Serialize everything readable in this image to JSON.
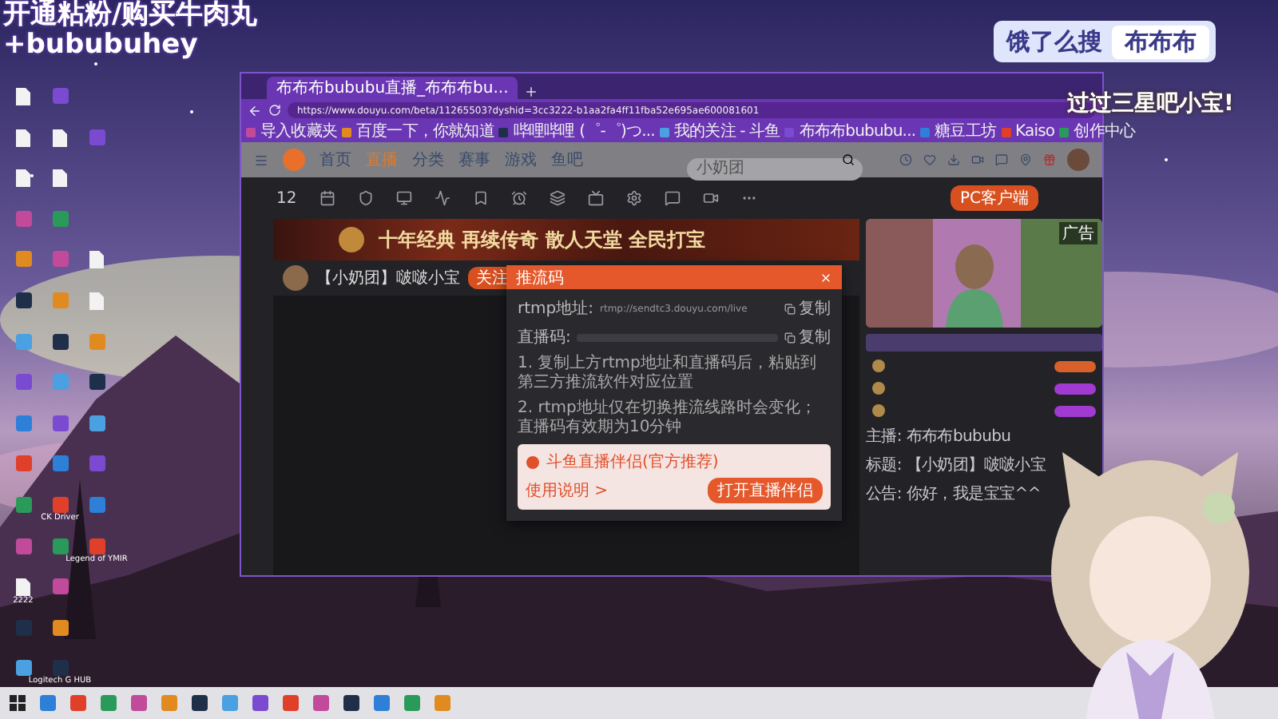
{
  "overlay": {
    "headline": [
      "开通粘粉/购买牛肉丸",
      "+bububuhey"
    ],
    "search_badge": {
      "prefix": "饿了么搜",
      "query": "布布布"
    },
    "caption": "过过三星吧小宝!"
  },
  "desktop_icons": [
    {
      "kind": "file"
    },
    {
      "kind": "file"
    },
    {
      "kind": "file"
    },
    {
      "kind": "app"
    },
    {
      "kind": "app"
    },
    {
      "kind": "app"
    },
    {
      "kind": "app"
    },
    {
      "kind": "app"
    },
    {
      "kind": "app"
    },
    {
      "kind": "app"
    },
    {
      "kind": "app"
    },
    {
      "kind": "app"
    },
    {
      "kind": "file",
      "label": "2222"
    },
    {
      "kind": "app"
    },
    {
      "kind": "app"
    },
    {
      "kind": "app"
    },
    {
      "kind": "file"
    },
    {
      "kind": "file"
    },
    {
      "kind": "app"
    },
    {
      "kind": "app"
    },
    {
      "kind": "app"
    },
    {
      "kind": "app"
    },
    {
      "kind": "app"
    },
    {
      "kind": "app"
    },
    {
      "kind": "app"
    },
    {
      "kind": "app",
      "label": "CK Driver"
    },
    {
      "kind": "app"
    },
    {
      "kind": "app"
    },
    {
      "kind": "app"
    },
    {
      "kind": "app",
      "label": "Logitech G HUB"
    },
    {
      "kind": "blank"
    },
    {
      "kind": "app"
    },
    {
      "kind": "blank"
    },
    {
      "kind": "blank"
    },
    {
      "kind": "file"
    },
    {
      "kind": "file"
    },
    {
      "kind": "app"
    },
    {
      "kind": "app"
    },
    {
      "kind": "app"
    },
    {
      "kind": "app"
    },
    {
      "kind": "app"
    },
    {
      "kind": "app",
      "label": "Legend of YMIR"
    },
    {
      "kind": "blank"
    },
    {
      "kind": "blank"
    },
    {
      "kind": "blank"
    }
  ],
  "browser": {
    "tabs": [
      {
        "title": "布布布bububu直播_布布布bu...",
        "selected": true
      }
    ],
    "url": "https://www.douyu.com/beta/11265503?dyshid=3cc3222-b1aa2fa4ff11fba52e695ae600081601",
    "bookmarks": [
      "导入收藏夹",
      "百度一下，你就知道",
      "哔哩哔哩 (゜-゜)つ...",
      "我的关注 - 斗鱼",
      "布布布bububu...",
      "糖豆工坊",
      "Kaiso",
      "创作中心"
    ]
  },
  "site": {
    "nav": [
      {
        "label": "首页",
        "selected": false
      },
      {
        "label": "直播",
        "selected": true
      },
      {
        "label": "分类",
        "selected": false
      },
      {
        "label": "赛事",
        "selected": false
      },
      {
        "label": "游戏",
        "selected": false
      },
      {
        "label": "鱼吧",
        "selected": false
      }
    ],
    "search": {
      "placeholder": "小奶团"
    },
    "toolbar": {
      "count": "12",
      "client_button": "PC客户端"
    },
    "banner": "十年经典 再续传奇 散人天堂 全民打宝",
    "room": {
      "title": "【小奶团】啵啵小宝",
      "follow_button": "关注"
    },
    "dialog": {
      "title": "推流码",
      "rows": [
        {
          "label": "rtmp地址:",
          "value": "rtmp://sendtc3.douyu.com/live",
          "action": "复制"
        },
        {
          "label": "直播码:",
          "action": "复制"
        }
      ],
      "steps": [
        "1. 复制上方rtmp地址和直播码后，粘贴到第三方推流软件对应位置",
        "2. rtmp地址仅在切换推流线路时会变化；直播码有效期为10分钟"
      ],
      "promo": {
        "title": "斗鱼直播伴侣(官方推荐)",
        "link": "使用说明 >",
        "button": "打开直播伴侣"
      }
    },
    "side_panel": {
      "ad_tag": "广告",
      "info": [
        "主播: 布布布bububu",
        "标题: 【小奶团】啵啵小宝",
        "公告: 你好，我是宝宝^^"
      ]
    }
  }
}
